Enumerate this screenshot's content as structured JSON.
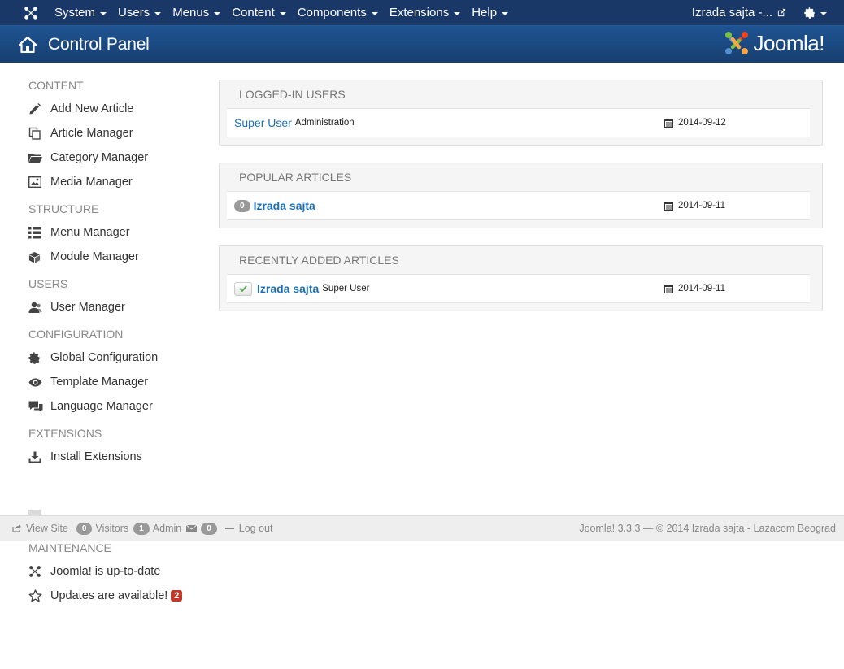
{
  "navbar": {
    "menus": [
      {
        "label": "System"
      },
      {
        "label": "Users"
      },
      {
        "label": "Menus"
      },
      {
        "label": "Content"
      },
      {
        "label": "Components"
      },
      {
        "label": "Extensions"
      },
      {
        "label": "Help"
      }
    ],
    "site_label": "Izrada sajta -...",
    "icons": {
      "logo": "joomla-icon",
      "external": "external-link-icon",
      "settings": "gear-icon"
    }
  },
  "header": {
    "title": "Control Panel",
    "brand": "Joomla!",
    "icons": {
      "home": "home-icon",
      "brand_logo": "joomla-logo"
    }
  },
  "sidebar": {
    "sections": [
      {
        "heading": "CONTENT",
        "items": [
          {
            "label": "Add New Article",
            "icon": "pencil-icon"
          },
          {
            "label": "Article Manager",
            "icon": "copy-icon"
          },
          {
            "label": "Category Manager",
            "icon": "folder-icon"
          },
          {
            "label": "Media Manager",
            "icon": "image-icon"
          }
        ]
      },
      {
        "heading": "STRUCTURE",
        "items": [
          {
            "label": "Menu Manager",
            "icon": "list-icon"
          },
          {
            "label": "Module Manager",
            "icon": "cube-icon"
          }
        ]
      },
      {
        "heading": "USERS",
        "items": [
          {
            "label": "User Manager",
            "icon": "users-icon"
          }
        ]
      },
      {
        "heading": "CONFIGURATION",
        "items": [
          {
            "label": "Global Configuration",
            "icon": "gear-icon"
          },
          {
            "label": "Template Manager",
            "icon": "eye-icon"
          },
          {
            "label": "Language Manager",
            "icon": "comments-icon"
          }
        ]
      },
      {
        "heading": "EXTENSIONS",
        "items": [
          {
            "label": "Install Extensions",
            "icon": "download-icon"
          }
        ]
      },
      {
        "heading": "MAINTENANCE",
        "items": [
          {
            "label": "Joomla! is up-to-date",
            "icon": "joomla-icon"
          },
          {
            "label": "Updates are available!",
            "icon": "star-icon",
            "badge": "2"
          }
        ]
      }
    ]
  },
  "modules": {
    "logged_in": {
      "title": "LOGGED-IN USERS",
      "rows": [
        {
          "name": "Super User",
          "sub": "Administration",
          "date": "2014-09-12"
        }
      ]
    },
    "popular": {
      "title": "POPULAR ARTICLES",
      "rows": [
        {
          "hits": "0",
          "name": "Izrada sajta",
          "date": "2014-09-11"
        }
      ]
    },
    "recent": {
      "title": "RECENTLY ADDED ARTICLES",
      "rows": [
        {
          "name": "Izrada sajta",
          "sub": "Super User",
          "date": "2014-09-11",
          "status": "published-check-icon"
        }
      ]
    }
  },
  "statusbar": {
    "view_site": "View Site",
    "visitors_count": "0",
    "visitors_label": "Visitors",
    "admin_count": "1",
    "admin_label": "Admin",
    "messages_count": "0",
    "logout": "Log out",
    "footer": "Joomla! 3.3.3  —  © 2014 Izrada sajta - Lazacom Beograd"
  },
  "colors": {
    "navbar": "#1a3867",
    "header": "#1f5492",
    "link": "#1f6fb5",
    "badge_red": "#c0392b"
  }
}
